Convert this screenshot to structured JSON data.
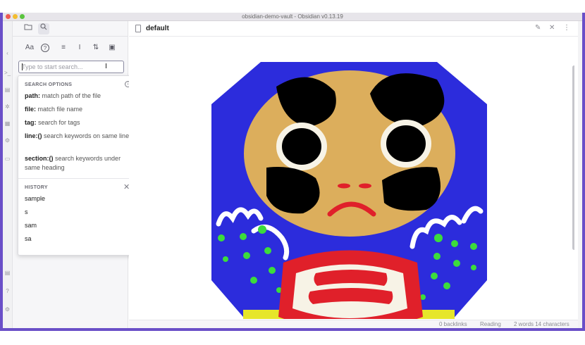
{
  "window": {
    "title": "obsidian-demo-vault - Obsidian v0.13.19"
  },
  "ribbon": {
    "icons": [
      "collapse-icon",
      "command-icon",
      "files-icon",
      "graph-icon",
      "calendar-icon",
      "folder-icon",
      "vault-icon",
      "help-icon",
      "settings-icon"
    ]
  },
  "sidebar": {
    "tabs": [
      "file-explorer-icon",
      "search-icon"
    ],
    "tools": [
      {
        "name": "match-case-icon",
        "glyph": "Aa"
      },
      {
        "name": "help-circle-icon",
        "glyph": "?"
      },
      {
        "name": "list-icon",
        "glyph": "≡"
      },
      {
        "name": "text-cursor-icon",
        "glyph": "I"
      },
      {
        "name": "sort-icon",
        "glyph": "⇅"
      },
      {
        "name": "copy-results-icon",
        "glyph": "▣"
      }
    ],
    "search": {
      "placeholder": "Type to start search...",
      "value": ""
    }
  },
  "popover": {
    "options_title": "SEARCH OPTIONS",
    "options": [
      {
        "key": "path:",
        "desc": "match path of the file"
      },
      {
        "key": "file:",
        "desc": "match file name"
      },
      {
        "key": "tag:",
        "desc": "search for tags"
      },
      {
        "key": "line:()",
        "desc": "search keywords on same line"
      },
      {
        "key": "section:()",
        "desc": "search keywords under same heading"
      }
    ],
    "history_title": "HISTORY",
    "history": [
      "sample",
      "s",
      "sam",
      "sa"
    ]
  },
  "main": {
    "tab_title": "default",
    "actions": [
      "edit-icon",
      "close-icon",
      "more-icon"
    ]
  },
  "status_bar": {
    "backlinks": "0 backlinks",
    "mode": "Reading",
    "counts": "2 words 14 characters"
  },
  "colors": {
    "accent": "#6a4fc8",
    "daruma_blue": "#2c2cdc",
    "daruma_skin": "#dcae5c",
    "daruma_red": "#e0202a",
    "daruma_yellow": "#e6e62a",
    "daruma_green": "#3cdc3c"
  }
}
